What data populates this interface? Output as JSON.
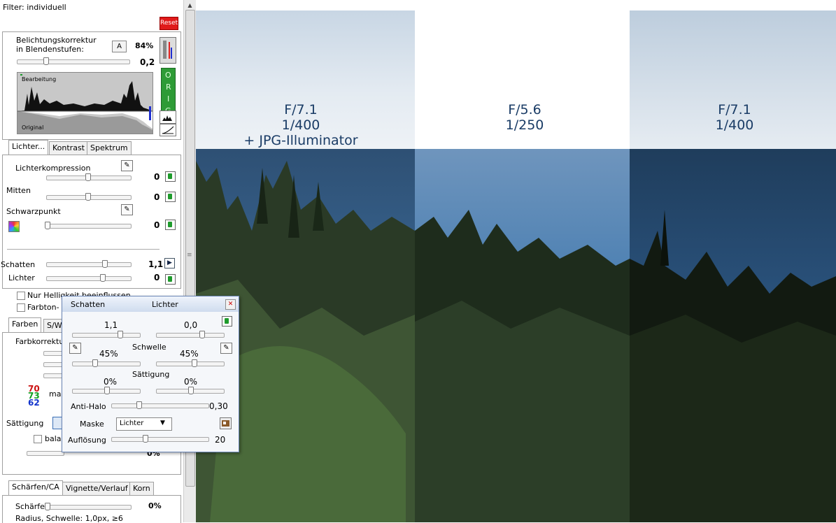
{
  "panel": {
    "filter_label": "Filter: individuell",
    "reset_label": "Reset",
    "exposure_label_1": "Belichtungskorrektur",
    "exposure_label_2": "in Blendenstufen:",
    "auto_label": "A",
    "zoom_percent": "84%",
    "exposure_value": "0,2",
    "exposure_slider": 0.25,
    "histogram_top_label": "Bearbeitung",
    "histogram_bottom_label": "Original",
    "orig_label": [
      "O",
      "R",
      "I",
      "G"
    ],
    "tabs_top": [
      "Lichter...",
      "Kontrast",
      "Spektrum"
    ],
    "lichterkompression_label": "Lichterkompression",
    "lichterkompression_value": "0",
    "mitten_label": "Mitten",
    "mitten_value": "0",
    "schwarzpunkt_label": "Schwarzpunkt",
    "schwarzpunkt_value": "0",
    "schatten_label": "Schatten",
    "schatten_value": "1,1",
    "lichter_label": "Lichter",
    "lichter_value": "0",
    "checkbox_1": "Nur Helligkeit beeinflussen",
    "checkbox_2": "Farbton-",
    "tabs_mid": [
      "Farben",
      "S/W"
    ],
    "farbkorrektur_label": "Farbkorrektu",
    "rgb_values": [
      "70",
      "73",
      "62"
    ],
    "rgb_suffix": "ma",
    "saettigung_label": "Sättigung",
    "bal_label": "bala",
    "pct_label": "0%",
    "tabs_bottom": [
      "Schärfen/CA",
      "Vignette/Verlauf",
      "Korn"
    ],
    "schaerfe_label": "Schärfe",
    "schaerfe_value": "0%",
    "radius_label": "Radius, Schwelle: 1,0px, ≥6"
  },
  "photo": {
    "left_caption": [
      "F/7.1",
      "1/400",
      "+ JPG-Illuminator"
    ],
    "mid_caption": [
      "F/5.6",
      "1/250"
    ],
    "right_caption": [
      "F/7.1",
      "1/400"
    ]
  },
  "popup": {
    "schatten_label": "Schatten",
    "lichter_label": "Lichter",
    "schatten_value": "1,1",
    "lichter_value": "0,0",
    "schwelle_label": "Schwelle",
    "schwelle_left": "45%",
    "schwelle_right": "45%",
    "saettigung_label": "Sättigung",
    "saettigung_left": "0%",
    "saettigung_right": "0%",
    "antihalo_label": "Anti-Halo",
    "antihalo_value": "0,30",
    "maske_label": "Maske",
    "maske_selected": "Lichter",
    "aufloesung_label": "Auflösung",
    "aufloesung_value": "20"
  },
  "colors": {
    "reset_red": "#e01a1a",
    "orig_green": "#2e9b36",
    "rgb_red": "#cc1111",
    "rgb_green": "#11a022",
    "rgb_blue": "#1133cc",
    "caption_blue": "#1a3c66"
  }
}
